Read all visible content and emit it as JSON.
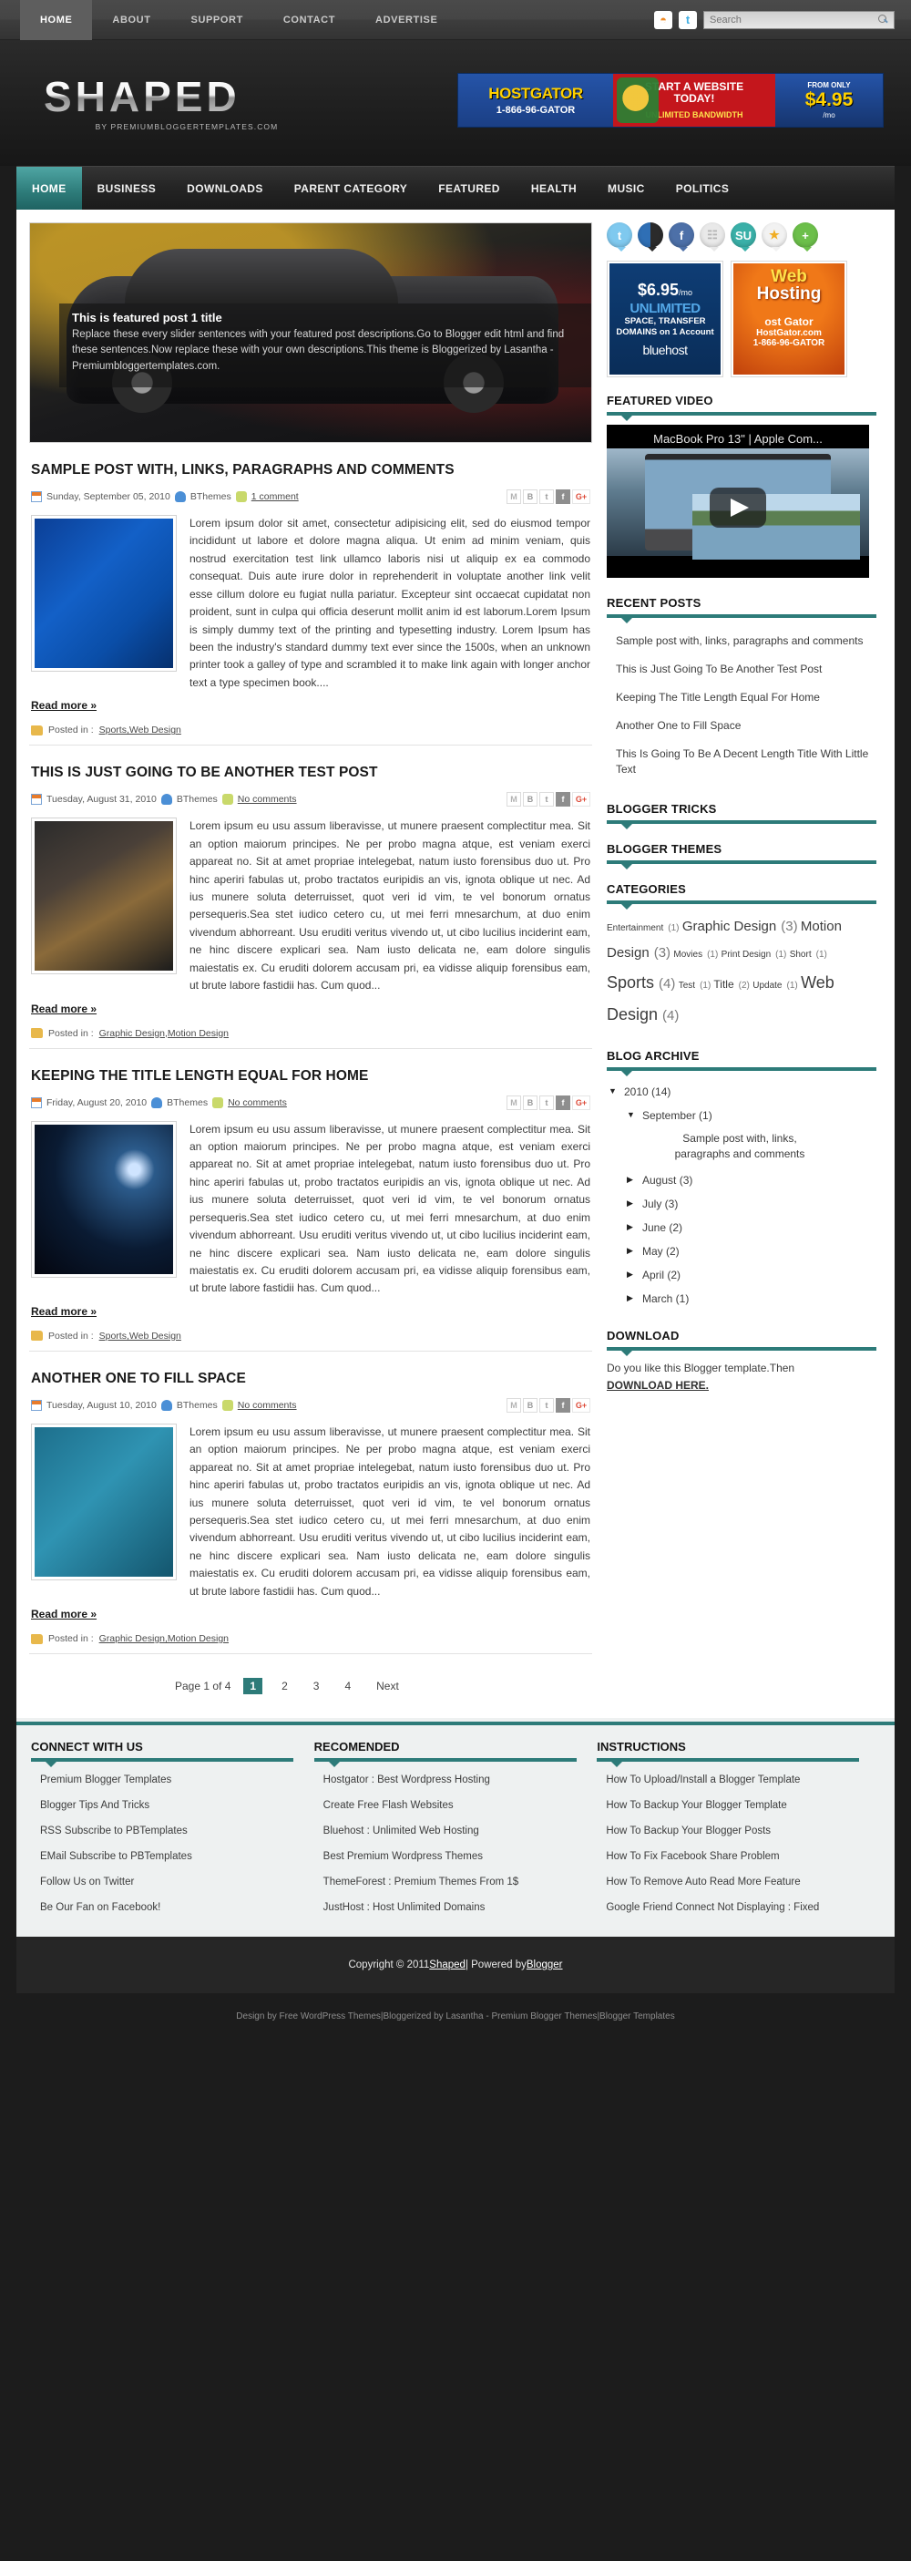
{
  "topbar": {
    "nav": [
      {
        "label": "HOME",
        "active": true
      },
      {
        "label": "ABOUT",
        "active": false
      },
      {
        "label": "SUPPORT",
        "active": false
      },
      {
        "label": "CONTACT",
        "active": false
      },
      {
        "label": "ADVERTISE",
        "active": false
      }
    ],
    "rss_icon": "rss-icon",
    "twitter_icon": "twitter-icon",
    "search_placeholder": "Search",
    "search_value": ""
  },
  "header": {
    "logo": "SHAPED",
    "tagline": "BY PREMIUMBLOGGERTEMPLATES.COM",
    "banner": {
      "left_title": "HOSTGATOR",
      "left_phone": "1-866-96-GATOR",
      "mid_line1": "START A WEBSITE",
      "mid_line2": "TODAY!",
      "mid_sub": "UNLIMITED BANDWIDTH",
      "right_line1": "FROM ONLY",
      "right_price": "$4.95",
      "right_period": "/mo"
    }
  },
  "mainnav": [
    {
      "label": "HOME",
      "active": true
    },
    {
      "label": "BUSINESS",
      "active": false
    },
    {
      "label": "DOWNLOADS",
      "active": false
    },
    {
      "label": "PARENT CATEGORY",
      "active": false
    },
    {
      "label": "FEATURED",
      "active": false
    },
    {
      "label": "HEALTH",
      "active": false
    },
    {
      "label": "MUSIC",
      "active": false
    },
    {
      "label": "POLITICS",
      "active": false
    }
  ],
  "slider": {
    "title": "This is featured post 1 title",
    "description": "Replace these every slider sentences with your featured post descriptions.Go to Blogger edit html and find these sentences.Now replace these with your own descriptions.This theme is Bloggerized by Lasantha - Premiumbloggertemplates.com."
  },
  "share_buttons": [
    {
      "name": "gmail-share",
      "glyph": "M"
    },
    {
      "name": "blogger-share",
      "glyph": "B"
    },
    {
      "name": "twitter-share",
      "glyph": "t"
    },
    {
      "name": "facebook-share",
      "glyph": "f"
    },
    {
      "name": "googleplus-share",
      "glyph": "G+"
    }
  ],
  "posts": [
    {
      "title": "SAMPLE POST WITH, LINKS, PARAGRAPHS AND COMMENTS",
      "date": "Sunday, September 05, 2010",
      "author": "BThemes",
      "comments": "1 comment",
      "body": "Lorem ipsum dolor sit amet, consectetur adipisicing elit, sed do eiusmod tempor incididunt ut labore et dolore magna aliqua. Ut enim ad minim veniam, quis nostrud exercitation test link ullamco laboris nisi ut aliquip ex ea commodo consequat. Duis aute irure dolor in reprehenderit in voluptate another link velit esse cillum dolore eu fugiat nulla pariatur. Excepteur sint occaecat cupidatat non proident, sunt in culpa qui officia deserunt mollit anim id est laborum.Lorem Ipsum is simply dummy text of the printing and typesetting industry. Lorem Ipsum has been the industry's standard dummy text ever since the 1500s, when an unknown printer took a galley of type and scrambled it to make link again with longer anchor text a type specimen book....",
      "readmore": "Read more »",
      "labels": "Sports,Web Design",
      "thumb_class": "th-news"
    },
    {
      "title": "THIS IS JUST GOING TO BE ANOTHER TEST POST",
      "date": "Tuesday, August 31, 2010",
      "author": "BThemes",
      "comments": "No comments",
      "body": "Lorem ipsum eu usu assum liberavisse, ut munere praesent complectitur mea. Sit an option maiorum principes. Ne per probo magna atque, est veniam exerci appareat no. Sit at amet propriae intelegebat, natum iusto forensibus duo ut. Pro hinc aperiri fabulas ut, probo tractatos euripidis an vis, ignota oblique ut nec. Ad ius munere soluta deterruisset, quot veri id vim, te vel bonorum ornatus persequeris.Sea stet iudico cetero cu, ut mei ferri mnesarchum, at duo enim vivendum abhorreant. Usu eruditi veritus vivendo ut, ut cibo lucilius inciderint eam, ne hinc discere explicari sea. Nam iusto delicata ne, eam dolore singulis maiestatis ex. Cu eruditi dolorem accusam pri, ea vidisse aliquip forensibus eam, ut brute labore fastidii has. Cum quod...",
      "readmore": "Read more »",
      "labels": "Graphic Design,Motion Design",
      "thumb_class": "th-key"
    },
    {
      "title": "KEEPING THE TITLE LENGTH EQUAL FOR HOME",
      "date": "Friday, August 20, 2010",
      "author": "BThemes",
      "comments": "No comments",
      "body": "Lorem ipsum eu usu assum liberavisse, ut munere praesent complectitur mea. Sit an option maiorum principes. Ne per probo magna atque, est veniam exerci appareat no. Sit at amet propriae intelegebat, natum iusto forensibus duo ut. Pro hinc aperiri fabulas ut, probo tractatos euripidis an vis, ignota oblique ut nec. Ad ius munere soluta deterruisset, quot veri id vim, te vel bonorum ornatus persequeris.Sea stet iudico cetero cu, ut mei ferri mnesarchum, at duo enim vivendum abhorreant. Usu eruditi veritus vivendo ut, ut cibo lucilius inciderint eam, ne hinc discere explicari sea. Nam iusto delicata ne, eam dolore singulis maiestatis ex. Cu eruditi dolorem accusam pri, ea vidisse aliquip forensibus eam, ut brute labore fastidii has. Cum quod...",
      "readmore": "Read more »",
      "labels": "Sports,Web Design",
      "thumb_class": "th-space"
    },
    {
      "title": "ANOTHER ONE TO FILL SPACE",
      "date": "Tuesday, August 10, 2010",
      "author": "BThemes",
      "comments": "No comments",
      "body": "Lorem ipsum eu usu assum liberavisse, ut munere praesent complectitur mea. Sit an option maiorum principes. Ne per probo magna atque, est veniam exerci appareat no. Sit at amet propriae intelegebat, natum iusto forensibus duo ut. Pro hinc aperiri fabulas ut, probo tractatos euripidis an vis, ignota oblique ut nec. Ad ius munere soluta deterruisset, quot veri id vim, te vel bonorum ornatus persequeris.Sea stet iudico cetero cu, ut mei ferri mnesarchum, at duo enim vivendum abhorreant. Usu eruditi veritus vivendo ut, ut cibo lucilius inciderint eam, ne hinc discere explicari sea. Nam iusto delicata ne, eam dolore singulis maiestatis ex. Cu eruditi dolorem accusam pri, ea vidisse aliquip forensibus eam, ut brute labore fastidii has. Cum quod...",
      "readmore": "Read more »",
      "labels": "Graphic Design,Motion Design",
      "thumb_class": "th-bin"
    }
  ],
  "pager": {
    "info": "Page 1 of 4",
    "pages": [
      "1",
      "2",
      "3",
      "4"
    ],
    "current": "1",
    "next": "Next"
  },
  "sidebar": {
    "social": [
      {
        "name": "twitter-bubble",
        "glyph": "t",
        "cls": "b-tw"
      },
      {
        "name": "delicious-bubble",
        "glyph": "",
        "cls": "b-dl"
      },
      {
        "name": "facebook-bubble",
        "glyph": "f",
        "cls": "b-fb"
      },
      {
        "name": "digg-bubble",
        "glyph": "☷",
        "cls": "b-dg"
      },
      {
        "name": "stumbleupon-bubble",
        "glyph": "SU",
        "cls": "b-su"
      },
      {
        "name": "favorites-bubble",
        "glyph": "★",
        "cls": "b-st"
      },
      {
        "name": "addthis-bubble",
        "glyph": "+",
        "cls": "b-pl"
      }
    ],
    "ad_bluehost": {
      "price": "$6.95",
      "period": "/mo",
      "unlimited": "UNLIMITED",
      "space": "SPACE, TRANSFER",
      "domains": "DOMAINS on 1 Account",
      "brand": "bluehost"
    },
    "ad_hostgator": {
      "web": "Web",
      "hosting": "Hosting",
      "gator": "ost Gator",
      "site": "HostGator.com",
      "phone": "1-866-96-GATOR"
    },
    "featured_video": {
      "title": "FEATURED VIDEO",
      "video_title": "MacBook Pro 13\" | Apple Com..."
    },
    "recent_posts": {
      "title": "RECENT POSTS",
      "items": [
        "Sample post with, links, paragraphs and comments",
        "This is Just Going To Be Another Test Post",
        "Keeping The Title Length Equal For Home",
        "Another One to Fill Space",
        "This Is Going To Be A Decent Length Title With Little Text"
      ]
    },
    "blogger_tricks": {
      "title": "BLOGGER TRICKS"
    },
    "blogger_themes": {
      "title": "BLOGGER THEMES"
    },
    "categories": {
      "title": "CATEGORIES",
      "items": [
        {
          "label": "Entertainment",
          "count": "(1)",
          "size": "sz1"
        },
        {
          "label": "Graphic Design",
          "count": "(3)",
          "size": "sz3"
        },
        {
          "label": "Motion Design",
          "count": "(3)",
          "size": "sz3"
        },
        {
          "label": "Movies",
          "count": "(1)",
          "size": "sz1"
        },
        {
          "label": "Print Design",
          "count": "(1)",
          "size": "sz1"
        },
        {
          "label": "Short",
          "count": "(1)",
          "size": "sz1"
        },
        {
          "label": "Sports",
          "count": "(4)",
          "size": "sz4"
        },
        {
          "label": "Test",
          "count": "(1)",
          "size": "sz1"
        },
        {
          "label": "Title",
          "count": "(2)",
          "size": "sz2"
        },
        {
          "label": "Update",
          "count": "(1)",
          "size": "sz1"
        },
        {
          "label": "Web Design",
          "count": "(4)",
          "size": "sz4"
        }
      ]
    },
    "blog_archive": {
      "title": "BLOG ARCHIVE",
      "year": "2010 (14)",
      "year_arrow": "▼",
      "month_open": "September (1)",
      "month_open_arrow": "▼",
      "month_open_post": "Sample post with, links, paragraphs and comments",
      "months": [
        {
          "label": "August (3)",
          "arrow": "▶"
        },
        {
          "label": "July (3)",
          "arrow": "▶"
        },
        {
          "label": "June (2)",
          "arrow": "▶"
        },
        {
          "label": "May (2)",
          "arrow": "▶"
        },
        {
          "label": "April (2)",
          "arrow": "▶"
        },
        {
          "label": "March (1)",
          "arrow": "▶"
        }
      ]
    },
    "download": {
      "title": "DOWNLOAD",
      "text": "Do you like this Blogger template.Then",
      "link": "DOWNLOAD HERE."
    }
  },
  "footer": {
    "columns": [
      {
        "title": "CONNECT WITH US",
        "items": [
          "Premium Blogger Templates",
          "Blogger Tips And Tricks",
          "RSS Subscribe to PBTemplates",
          "EMail Subscribe to PBTemplates",
          "Follow Us on Twitter",
          "Be Our Fan on Facebook!"
        ]
      },
      {
        "title": "RECOMENDED",
        "items": [
          "Hostgator : Best Wordpress Hosting",
          "Create Free Flash Websites",
          "Bluehost : Unlimited Web Hosting",
          "Best Premium Wordpress Themes",
          "ThemeForest : Premium Themes From 1$",
          "JustHost : Host Unlimited Domains"
        ]
      },
      {
        "title": "INSTRUCTIONS",
        "items": [
          "How To Upload/Install a Blogger Template",
          "How To Backup Your Blogger Template",
          "How To Backup Your Blogger Posts",
          "How To Fix Facebook Share Problem",
          "How To Remove Auto Read More Feature",
          "Google Friend Connect Not Displaying : Fixed"
        ]
      }
    ],
    "copyright_pre": "Copyright © 2011 ",
    "copyright_site": "Shaped",
    "copyright_mid": " | Powered by ",
    "copyright_blogger": "Blogger",
    "credits_1": "Design by Free WordPress Themes",
    "credits_sep1": " | ",
    "credits_2": "Bloggerized by Lasantha - Premium Blogger Themes",
    "credits_sep2": " | ",
    "credits_3": "Blogger Templates"
  },
  "colors": {
    "accent": "#2d7b79",
    "dark": "#1c1c1c",
    "footer_bg": "#eef1f1"
  }
}
